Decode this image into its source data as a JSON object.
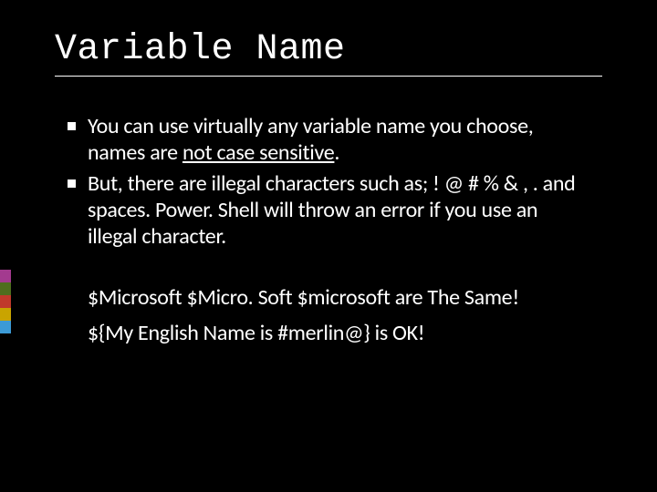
{
  "title": "Variable Name",
  "bullets": [
    {
      "pre": "You can use virtually any variable name you choose, names are ",
      "emph": "not case sensitive",
      "post": "."
    },
    {
      "pre": "But, there are illegal characters such as; ! @ # % & , . and spaces. Power. Shell will throw an error if you use an illegal character.",
      "emph": "",
      "post": ""
    }
  ],
  "examples": {
    "line1": "$Microsoft $Micro. Soft $microsoft  are The Same!",
    "line2": "${My English Name is #merlin@}    is OK!"
  },
  "accent_colors": [
    "#a33a8f",
    "#4f6e1e",
    "#c0392b",
    "#c9a400",
    "#3c9ad6"
  ]
}
